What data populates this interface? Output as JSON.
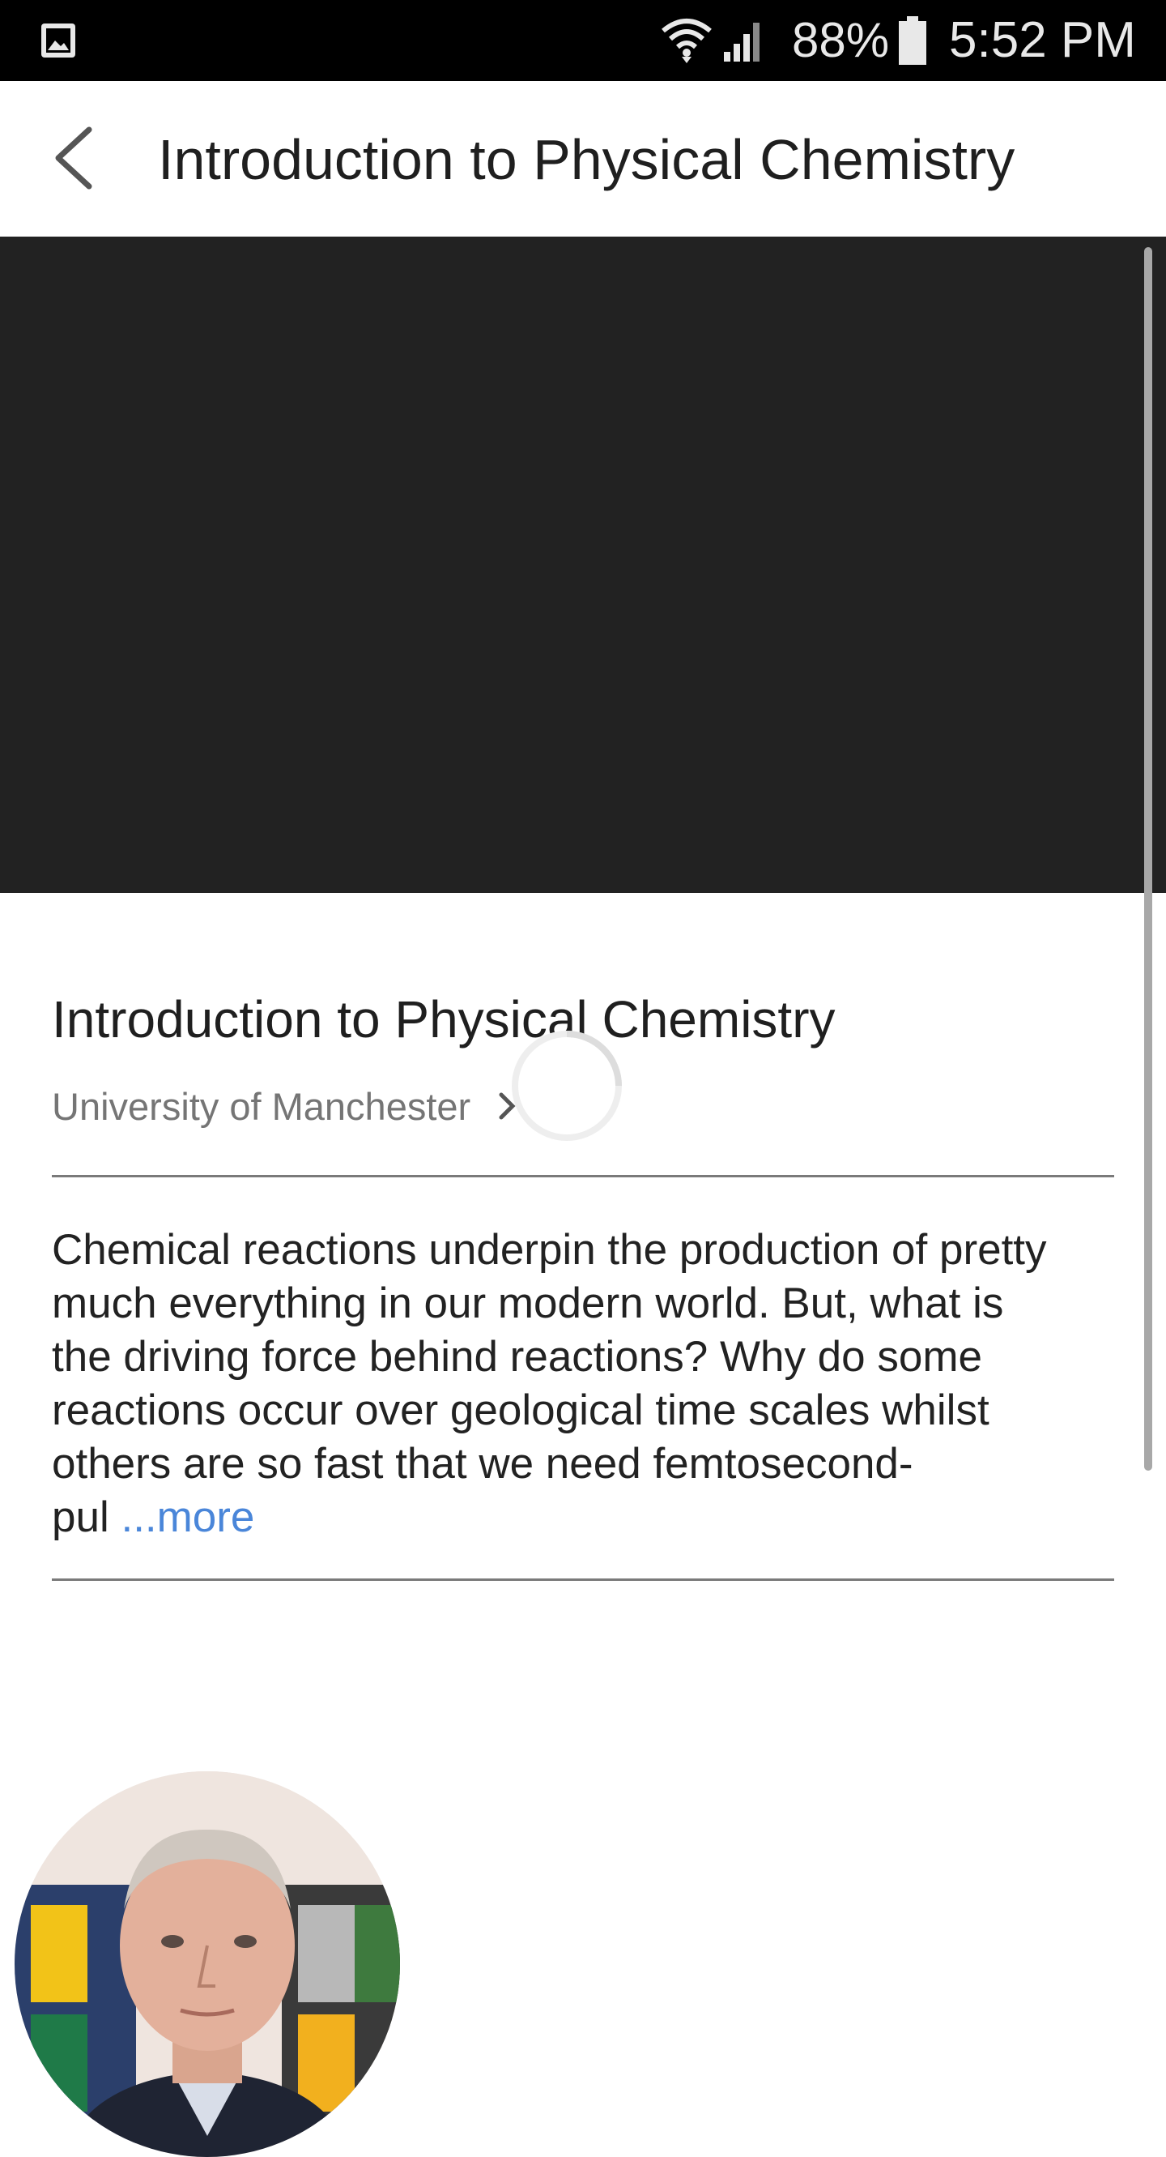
{
  "status_bar": {
    "battery_percent": "88%",
    "time": "5:52 PM",
    "icons": [
      "gallery-icon",
      "wifi-icon",
      "signal-icon",
      "battery-icon"
    ]
  },
  "app_bar": {
    "title": "Introduction to Physical Chemistry",
    "back_icon": "chevron-left-icon"
  },
  "course": {
    "title": "Introduction to Physical Chemistry",
    "university": "University of Manchester",
    "description_lines": [
      "Chemical reactions underpin the production of pretty",
      "much everything in our modern world.  But, what is",
      "the driving force behind reactions?  Why do some",
      "reactions occur over geological time scales whilst",
      "others are so fast that we need femtosecond-",
      "pul"
    ],
    "more_label": "...more"
  },
  "colors": {
    "video_background": "#222222",
    "link_blue": "#4a86d9",
    "divider": "#7a7a7a"
  }
}
